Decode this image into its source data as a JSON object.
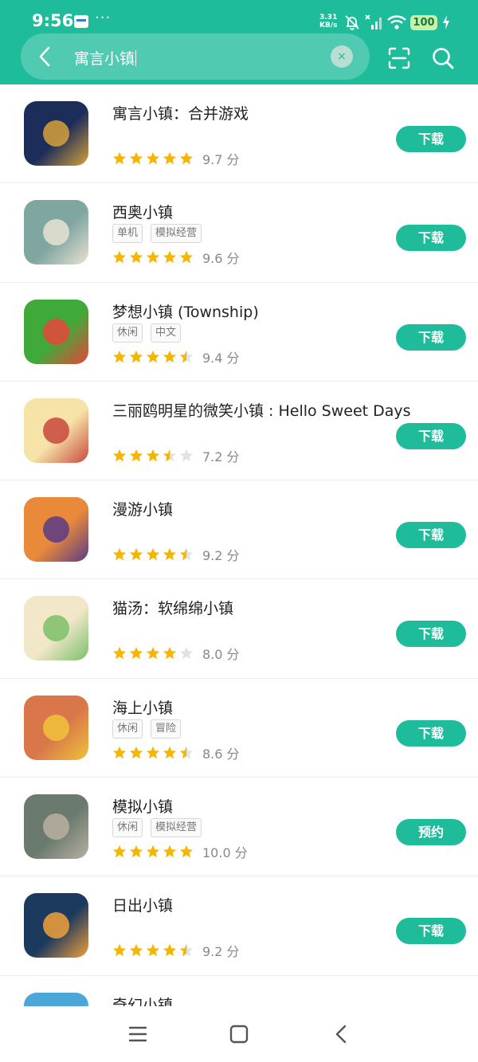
{
  "status_bar": {
    "time": "9:56",
    "dots": "···",
    "net_speed_value": "3.31",
    "net_speed_unit": "KB/s",
    "battery": "100"
  },
  "search": {
    "query": "寓言小镇",
    "clear_label": "×"
  },
  "apps": [
    {
      "name": "寓言小镇：合并游戏",
      "tags": [],
      "stars": 5,
      "score": "9.7 分",
      "action": "下载",
      "icon_color": "#1d2d5a",
      "icon_accent": "#d6a23c"
    },
    {
      "name": "西奥小镇",
      "tags": [
        "单机",
        "模拟经营"
      ],
      "stars": 5,
      "score": "9.6 分",
      "action": "下载",
      "icon_color": "#7fa6a0",
      "icon_accent": "#e9e2d2"
    },
    {
      "name": "梦想小镇 (Township)",
      "tags": [
        "休闲",
        "中文"
      ],
      "stars": 4.5,
      "score": "9.4 分",
      "action": "下载",
      "icon_color": "#3faa3a",
      "icon_accent": "#e8453c"
    },
    {
      "name": "三丽鸥明星的微笑小镇 : Hello Sweet Days",
      "tags": [],
      "stars": 3.5,
      "score": "7.2 分",
      "action": "下载",
      "icon_color": "#f6e3a8",
      "icon_accent": "#c9473d"
    },
    {
      "name": "漫游小镇",
      "tags": [],
      "stars": 4.5,
      "score": "9.2 分",
      "action": "下载",
      "icon_color": "#e98a3a",
      "icon_accent": "#5a3b86"
    },
    {
      "name": "猫汤：软绵绵小镇",
      "tags": [],
      "stars": 4,
      "score": "8.0 分",
      "action": "下载",
      "icon_color": "#f3e7c9",
      "icon_accent": "#7bbf6a"
    },
    {
      "name": "海上小镇",
      "tags": [
        "休闲",
        "冒险"
      ],
      "stars": 4.5,
      "score": "8.6 分",
      "action": "下载",
      "icon_color": "#d9774a",
      "icon_accent": "#f0c23a"
    },
    {
      "name": "模拟小镇",
      "tags": [
        "休闲",
        "模拟经营"
      ],
      "stars": 5,
      "score": "10.0 分",
      "action": "预约",
      "icon_color": "#6b7a6f",
      "icon_accent": "#b9b0a0"
    },
    {
      "name": "日出小镇",
      "tags": [],
      "stars": 4.5,
      "score": "9.2 分",
      "action": "下载",
      "icon_color": "#1c3a5e",
      "icon_accent": "#f1a13a"
    },
    {
      "name": "奇幻小镇",
      "tags": [],
      "stars": 0,
      "score": "",
      "action": "",
      "icon_color": "#4aa7d8",
      "icon_accent": "#f4f4f4"
    }
  ],
  "colors": {
    "accent": "#1fbc9c",
    "star_on": "#f7b500",
    "star_off": "#e2e2e2"
  }
}
